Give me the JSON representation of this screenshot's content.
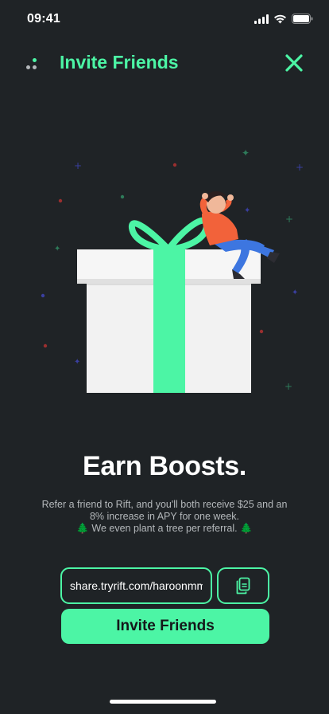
{
  "status_bar": {
    "time": "09:41"
  },
  "header": {
    "title": "Invite Friends"
  },
  "headline": "Earn Boosts.",
  "description": {
    "line1": "Refer a friend to Rift, and you'll both receive $25 and an 8% increase in APY for one week.",
    "line2": "🌲 We even plant a tree per referral. 🌲"
  },
  "share_link": {
    "value": "share.tryrift.com/haroonmm"
  },
  "invite_button": {
    "label": "Invite Friends"
  },
  "colors": {
    "background": "#1f2326",
    "accent": "#4cf5a5",
    "text_secondary": "#b4b8bb"
  },
  "icons": {
    "menu": "dots-icon",
    "close": "close-icon",
    "copy": "copy-icon",
    "signal": "signal-icon",
    "wifi": "wifi-icon",
    "battery": "battery-icon"
  }
}
